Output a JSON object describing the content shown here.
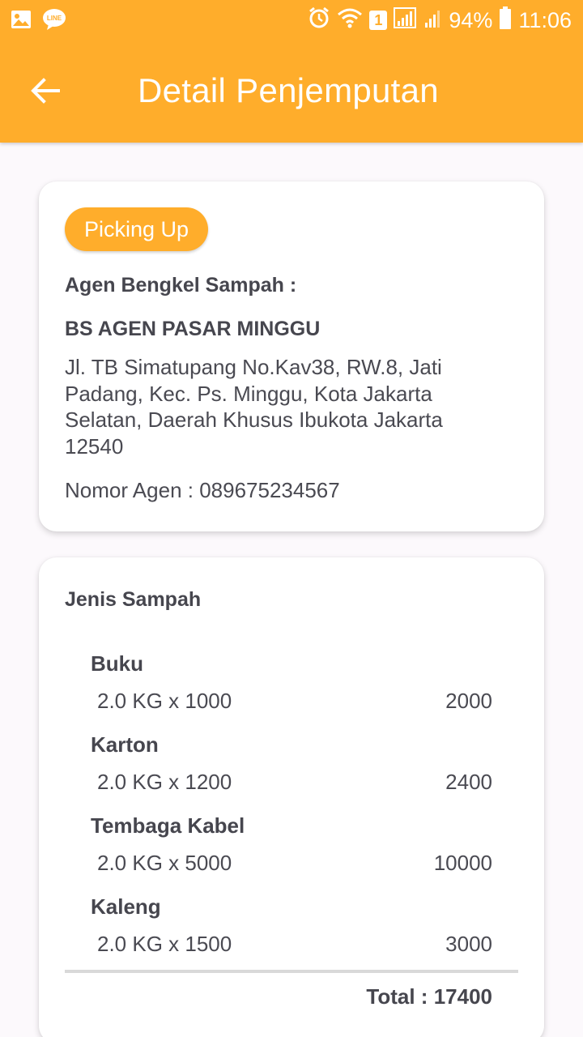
{
  "status_bar": {
    "battery": "94%",
    "time": "11:06",
    "sim_badge": "1",
    "left_icons": [
      "gallery-icon",
      "line-app-icon"
    ],
    "right_icons": [
      "alarm-icon",
      "wifi-icon",
      "signal-icon",
      "signal-icon",
      "battery-icon"
    ]
  },
  "app_bar": {
    "title": "Detail Penjemputan",
    "back_icon": "arrow-left-icon"
  },
  "agent_card": {
    "status": "Picking Up",
    "label": "Agen Bengkel Sampah :",
    "name": "BS AGEN PASAR MINGGU",
    "address": "Jl. TB Simatupang No.Kav38, RW.8, Jati Padang, Kec. Ps. Minggu, Kota Jakarta Selatan, Daerah Khusus Ibukota Jakarta 12540",
    "phone": "Nomor Agen : 089675234567"
  },
  "items_card": {
    "title": "Jenis Sampah",
    "items": [
      {
        "name": "Buku",
        "qty": "2.0 KG x 1000",
        "subtotal": "2000"
      },
      {
        "name": "Karton",
        "qty": "2.0 KG x 1200",
        "subtotal": "2400"
      },
      {
        "name": "Tembaga Kabel",
        "qty": "2.0 KG x 5000",
        "subtotal": "10000"
      },
      {
        "name": "Kaleng",
        "qty": "2.0 KG x 1500",
        "subtotal": "3000"
      }
    ],
    "total": "Total : 17400"
  },
  "colors": {
    "primary": "#ffad2b",
    "background": "#fcf9fc",
    "card": "#ffffff",
    "text": "#4a4a52"
  }
}
